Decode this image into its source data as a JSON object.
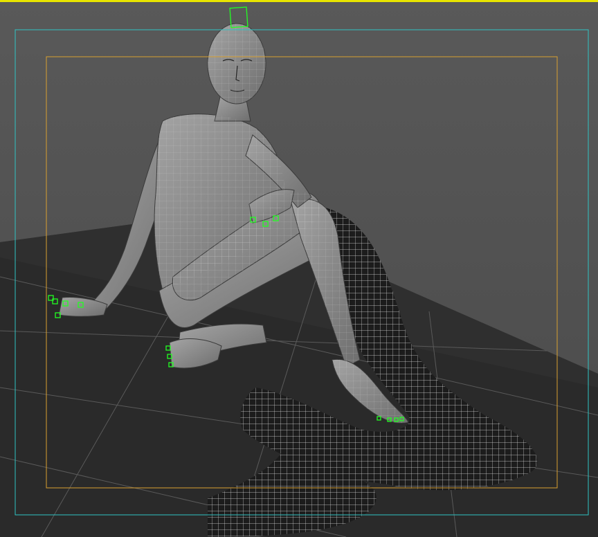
{
  "viewport": {
    "colors": {
      "background": "#555555",
      "active_border": "#e8e400",
      "safe_action_frame": "#2fc4c4",
      "resolution_gate": "#d9a030",
      "controls": "#22ff22",
      "wireframe": "#ffffff",
      "ground_plane": "#2a2a2a",
      "skin_shading": "#8c8c8c"
    },
    "scene": {
      "character": "seated-figure-wireframe",
      "cloth": "draped-cloth-mesh",
      "ground": "ground-plane-grid"
    },
    "icons": {
      "head_control": "square-control-icon",
      "finger_controls": "circle-control-icon"
    }
  }
}
